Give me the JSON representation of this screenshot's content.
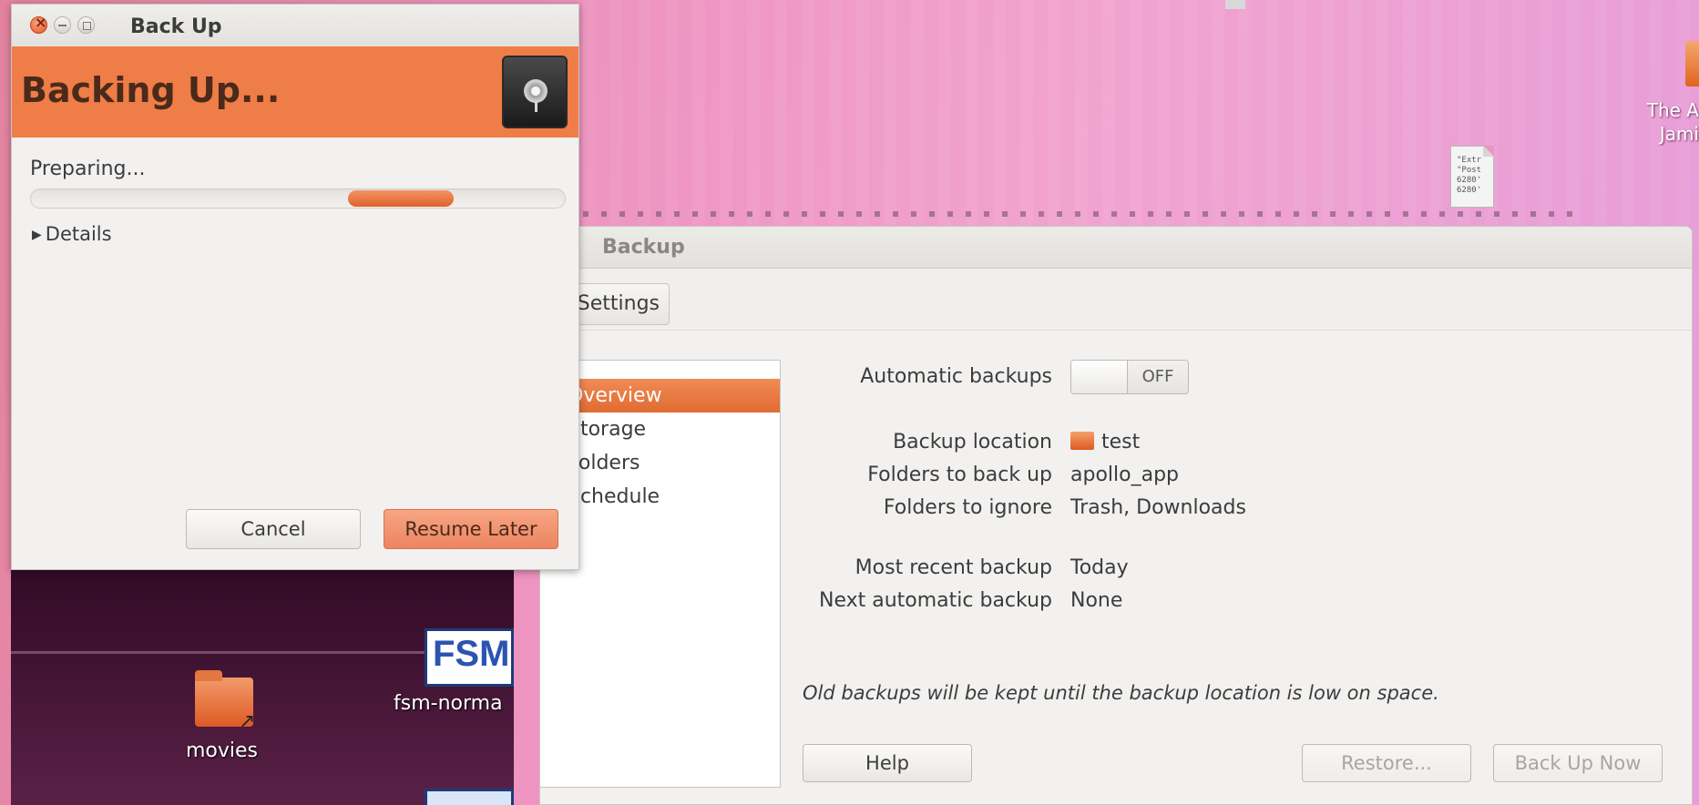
{
  "desktop": {
    "icons": [
      {
        "label": "movies",
        "name": "movies-folder"
      },
      {
        "label": "fsm-norma",
        "name": "fsm-normal"
      }
    ],
    "right_edge_text": "The A\nJami",
    "file_icon_text": "\"Extr\n\"Post\n6280'\n6280'",
    "fsm_logo_text": "FSM"
  },
  "progress_dialog": {
    "title": "Back Up",
    "heading": "Backing Up...",
    "status": "Preparing...",
    "details_label": "Details",
    "cancel_label": "Cancel",
    "resume_label": "Resume Later",
    "accent_color": "#ef7d47"
  },
  "backup_window": {
    "title": "Backup",
    "settings_label": "Settings",
    "sidebar": {
      "items": [
        {
          "label": "Overview",
          "selected": true
        },
        {
          "label": "Storage",
          "selected": false
        },
        {
          "label": "Folders",
          "selected": false
        },
        {
          "label": "Schedule",
          "selected": false
        }
      ]
    },
    "overview": {
      "automatic_backups_label": "Automatic backups",
      "automatic_backups_state": "OFF",
      "backup_location_label": "Backup location",
      "backup_location_value": "test",
      "folders_to_back_up_label": "Folders to back up",
      "folders_to_back_up_value": "apollo_app",
      "folders_to_ignore_label": "Folders to ignore",
      "folders_to_ignore_value": "Trash, Downloads",
      "most_recent_label": "Most recent backup",
      "most_recent_value": "Today",
      "next_auto_label": "Next automatic backup",
      "next_auto_value": "None",
      "note": "Old backups will be kept until the backup location is low on space."
    },
    "buttons": {
      "help": "Help",
      "restore": "Restore...",
      "back_up_now": "Back Up Now"
    }
  }
}
